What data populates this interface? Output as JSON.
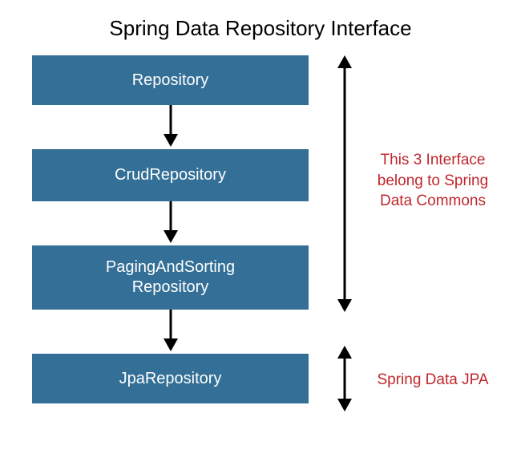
{
  "title": "Spring Data Repository Interface",
  "boxes": {
    "b1": "Repository",
    "b2": "CrudRepository",
    "b3_line1": "PagingAndSorting",
    "b3_line2": "Repository",
    "b4": "JpaRepository"
  },
  "annotations": {
    "commons_line1": "This 3 Interface",
    "commons_line2": "belong to Spring",
    "commons_line3": "Data Commons",
    "jpa": "Spring Data JPA"
  },
  "colors": {
    "box_bg": "#336f96",
    "annotation": "#c1272d"
  }
}
